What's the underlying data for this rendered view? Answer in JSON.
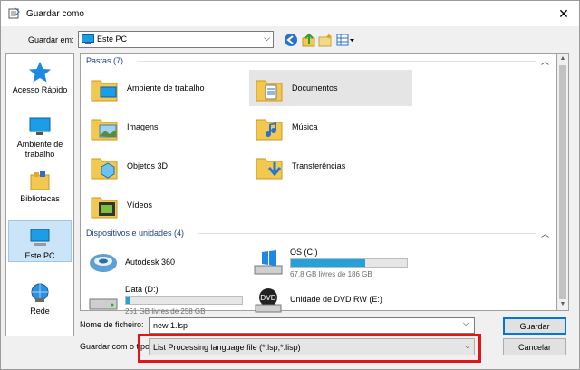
{
  "window": {
    "title": "Guardar como",
    "close_glyph": "✕"
  },
  "toolbar": {
    "save_in_label": "Guardar em:",
    "location": "Este PC",
    "icons": [
      "back-icon",
      "up-folder-icon",
      "new-folder-icon",
      "view-menu-icon"
    ]
  },
  "places": [
    {
      "label": "Acesso Rápido",
      "icon": "star-icon"
    },
    {
      "label": "Ambiente de trabalho",
      "icon": "desktop-icon"
    },
    {
      "label": "Bibliotecas",
      "icon": "libraries-icon"
    },
    {
      "label": "Este PC",
      "icon": "computer-icon",
      "selected": true
    },
    {
      "label": "Rede",
      "icon": "network-icon"
    }
  ],
  "groups": {
    "folders_header": "Pastas (7)",
    "devices_header": "Dispositivos e unidades (4)"
  },
  "folders": [
    {
      "name": "Ambiente de trabalho"
    },
    {
      "name": "Documentos",
      "highlighted": true
    },
    {
      "name": "Imagens"
    },
    {
      "name": "Música"
    },
    {
      "name": "Objetos 3D"
    },
    {
      "name": "Transferências"
    },
    {
      "name": "Vídeos"
    }
  ],
  "drives": [
    {
      "name": "Autodesk 360"
    },
    {
      "name": "OS (C:)",
      "free": "67,8 GB livres de 186 GB",
      "used_fraction": 0.64,
      "bar_color": "#26a0da"
    },
    {
      "name": "Data (D:)",
      "free": "251 GB livres de 258 GB",
      "used_fraction": 0.03,
      "bar_color": "#26a0da"
    },
    {
      "name": "Unidade de DVD RW (E:)"
    }
  ],
  "form": {
    "filename_label": "Nome de ficheiro:",
    "filename_value": "new 1.lsp",
    "filetype_label": "Guardar com o tipo:",
    "filetype_value": "List Processing language file (*.lsp;*.lisp)"
  },
  "buttons": {
    "save": "Guardar",
    "cancel": "Cancelar"
  },
  "colors": {
    "accent": "#0078d7",
    "highlight_box": "#e1141a",
    "folder": "#f3c851"
  }
}
